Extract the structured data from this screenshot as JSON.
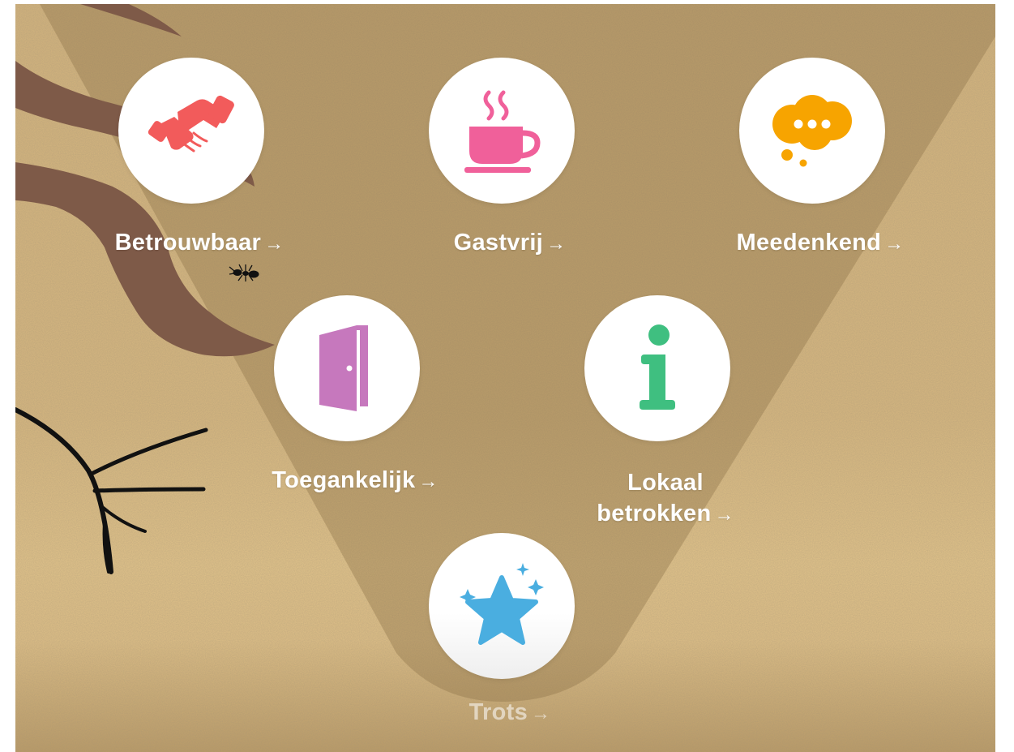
{
  "values": [
    {
      "id": "betrouwbaar",
      "label": "Betrouwbaar",
      "arrow": "→",
      "icon": "handshake-icon",
      "color": "#f25b5b"
    },
    {
      "id": "gastvrij",
      "label": "Gastvrij",
      "arrow": "→",
      "icon": "coffee-cup-icon",
      "color": "#f0609a"
    },
    {
      "id": "meedenkend",
      "label": "Meedenkend",
      "arrow": "→",
      "icon": "thought-bubble-icon",
      "color": "#f7a400"
    },
    {
      "id": "toegankelijk",
      "label": "Toegankelijk",
      "arrow": "→",
      "icon": "open-door-icon",
      "color": "#c678bd"
    },
    {
      "id": "lokaal",
      "label_line1": "Lokaal",
      "label_line2": "betrokken",
      "arrow": "→",
      "icon": "info-icon",
      "color": "#3fbf80"
    },
    {
      "id": "trots",
      "label": "Trots",
      "arrow": "→",
      "icon": "sparkling-star-icon",
      "color": "#4aaee0"
    }
  ]
}
